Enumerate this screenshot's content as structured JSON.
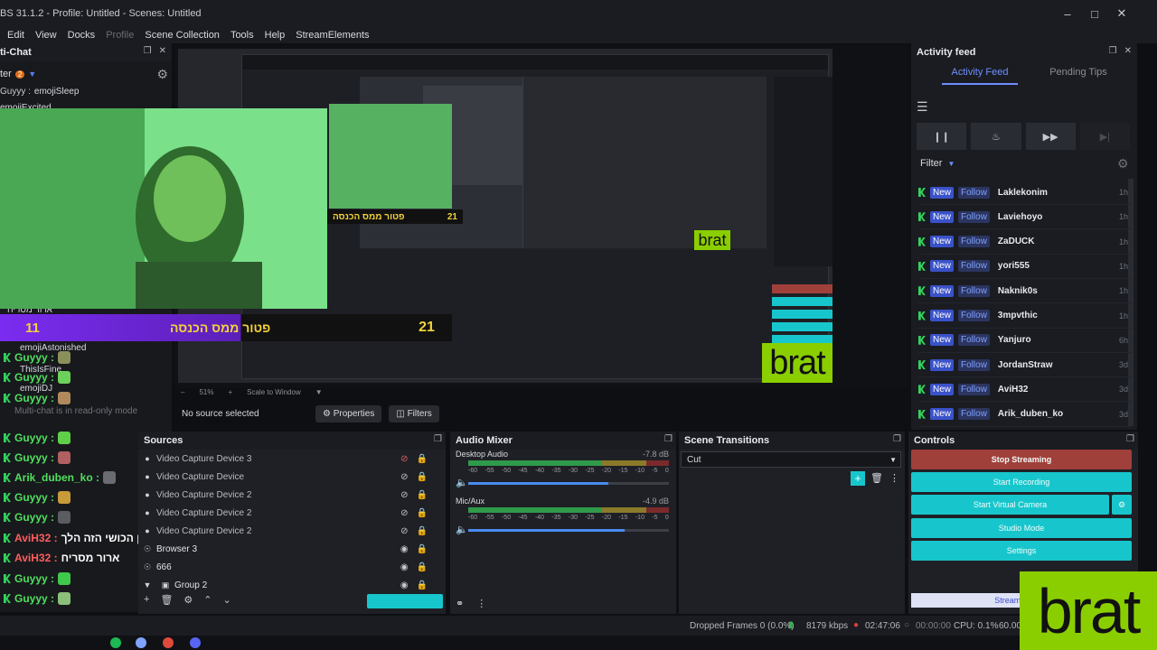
{
  "window": {
    "title": "BS 31.1.2 - Profile: Untitled - Scenes: Untitled"
  },
  "menu": [
    "Edit",
    "View",
    "Docks",
    "Profile",
    "Scene Collection",
    "Tools",
    "Help",
    "StreamElements"
  ],
  "chat": {
    "title": "ti-Chat",
    "filter_label": "ter",
    "filter_count": "2",
    "readonly_notice": "Multi-chat is in read-only mode",
    "lines": [
      {
        "user": "Guyyy :",
        "text": "emojiSleep"
      },
      {
        "user": "",
        "text": "emojiExcited"
      },
      {
        "user": "",
        "text": "ארור מסריח"
      },
      {
        "user": "",
        "text": "emojiAstonished"
      },
      {
        "user": "Guyyy :",
        "text": ""
      },
      {
        "user": "",
        "text": "ThisIsFine"
      },
      {
        "user": "Guyyy :",
        "text": ""
      },
      {
        "user": "",
        "text": "emojiDJ"
      },
      {
        "user": "Guyyy :",
        "text": ""
      },
      {
        "user": "Guyyy :",
        "text": ""
      },
      {
        "user": "Guyyy :",
        "text": ""
      },
      {
        "user": "Arik_duben_ko :",
        "text": ""
      },
      {
        "user": "Guyyy :",
        "text": ""
      },
      {
        "user": "Guyyy :",
        "text": ""
      },
      {
        "user": "AviH32 :",
        "text": "לאן הכושי הזה הלך"
      },
      {
        "user": "AviH32 :",
        "text": "ארור מסריח"
      },
      {
        "user": "Guyyy :",
        "text": ""
      },
      {
        "user": "Guyyy :",
        "text": ""
      },
      {
        "user": "Guyyy :",
        "text": ""
      },
      {
        "user": "Guyyy :",
        "text": ""
      }
    ]
  },
  "overlay": {
    "score_left": "11",
    "score_right": "21",
    "banner": "פטור ממס הכנסה",
    "brat_small": "brat",
    "brat_big": "brat"
  },
  "preview": {
    "zoom": "51%",
    "scale_mode": "Scale to Window"
  },
  "source_toolbar": {
    "no_source": "No source selected",
    "properties": "Properties",
    "filters": "Filters"
  },
  "sources": {
    "title": "Sources",
    "items": [
      "Video Capture Device 3",
      "Video Capture Device",
      "Video Capture Device 2",
      "Video Capture Device 2",
      "Video Capture Device 2",
      "Browser 3",
      "666",
      "Group 2"
    ]
  },
  "mixer": {
    "title": "Audio Mixer",
    "channels": [
      {
        "name": "Desktop Audio",
        "db": "-7.8 dB",
        "volume": 0.7
      },
      {
        "name": "Mic/Aux",
        "db": "-4.9 dB",
        "volume": 0.78
      }
    ],
    "ticks": [
      "-60",
      "-55",
      "-50",
      "-45",
      "-40",
      "-35",
      "-30",
      "-25",
      "-20",
      "-15",
      "-10",
      "-5",
      "0"
    ]
  },
  "transitions": {
    "title": "Scene Transitions",
    "selected": "Cut"
  },
  "controls": {
    "title": "Controls",
    "stop_streaming": "Stop Streaming",
    "start_recording": "Start Recording",
    "start_virtual_camera": "Start Virtual Camera",
    "studio_mode": "Studio Mode",
    "settings": "Settings",
    "streamelements": "StreamElemen"
  },
  "activity": {
    "dock_title": "Activity feed",
    "tab_feed": "Activity Feed",
    "tab_tips": "Pending Tips",
    "filter": "Filter",
    "tag_new": "New",
    "tag_follow": "Follow",
    "items": [
      {
        "name": "Laklekonim",
        "age": "1h"
      },
      {
        "name": "Laviehoyo",
        "age": "1h"
      },
      {
        "name": "ZaDUCK",
        "age": "1h"
      },
      {
        "name": "yori555",
        "age": "1h"
      },
      {
        "name": "Naknik0s",
        "age": "1h"
      },
      {
        "name": "3mpvthic",
        "age": "1h"
      },
      {
        "name": "Yanjuro",
        "age": "6h"
      },
      {
        "name": "JordanStraw",
        "age": "3d"
      },
      {
        "name": "AviH32",
        "age": "3d"
      },
      {
        "name": "Arik_duben_ko",
        "age": "3d"
      }
    ]
  },
  "status": {
    "dropped": "Dropped Frames 0 (0.0%)",
    "bitrate": "8179 kbps",
    "stream_time": "02:47:06",
    "rec_time": "00:00:00",
    "cpu": "CPU: 0.1%",
    "fps": "60.00"
  },
  "colors": {
    "accent": "#17c6cc",
    "stop": "#a0403a",
    "brat": "#8ace00",
    "kick": "#33d35d"
  }
}
